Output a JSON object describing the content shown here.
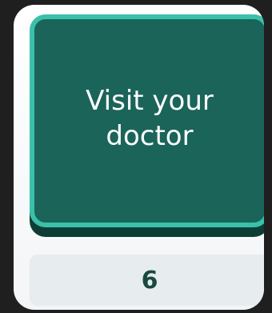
{
  "tile": {
    "label": "Visit your doctor",
    "colors": {
      "fill": "#1b6459",
      "border": "#3bc0aa",
      "shadow": "#0d3d34"
    }
  },
  "counter": {
    "value": "6"
  }
}
